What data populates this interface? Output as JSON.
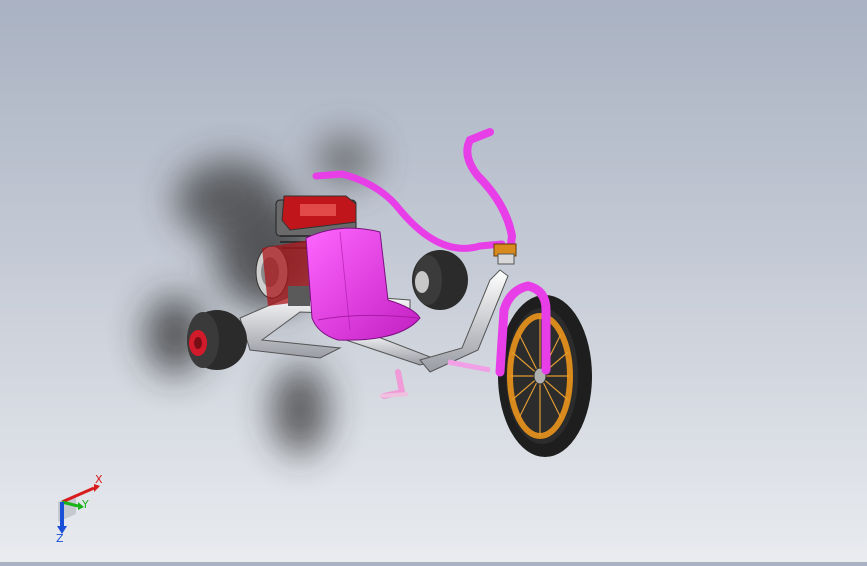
{
  "scene": {
    "model": "drift-trike",
    "colors": {
      "background_top": "#a9b2c2",
      "background_bottom": "#e9ebef",
      "seat_and_bars": "#e83ee8",
      "frame": "#e8e8ec",
      "engine_cover": "#c0151a",
      "tire": "#2b2b2b",
      "rim_front": "#d98a1c",
      "hub_rear": "#d11a2a"
    }
  },
  "triad": {
    "x_label": "X",
    "y_label": "Y",
    "z_label": "Z",
    "colors": {
      "x": "#d81b1b",
      "y": "#19b419",
      "z": "#1a4fd8"
    }
  }
}
